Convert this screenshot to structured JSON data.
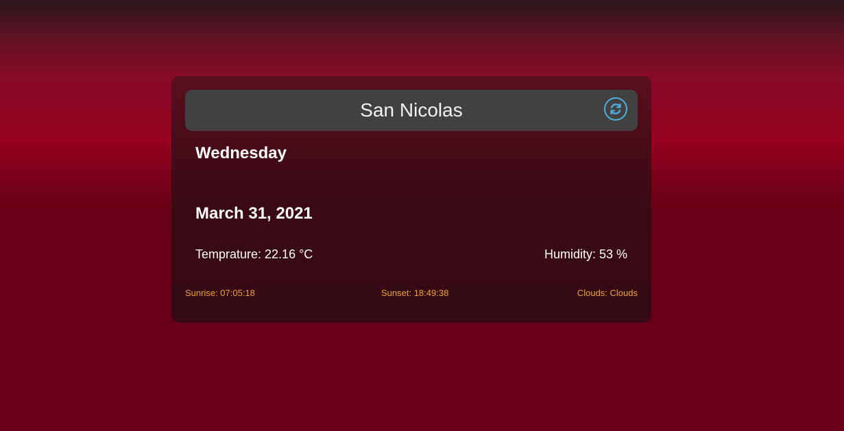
{
  "weather": {
    "city": "San Nicolas",
    "day": "Wednesday",
    "date": "March 31, 2021",
    "temperature": "Temprature: 22.16 °C",
    "humidity": "Humidity: 53 %",
    "sunrise": "Sunrise: 07:05:18",
    "sunset": "Sunset: 18:49:38",
    "clouds": "Clouds: Clouds"
  },
  "icons": {
    "refresh": "refresh-icon"
  },
  "colors": {
    "accent_icon": "#4fb0e0",
    "footer_text": "#e8a53a",
    "header_bg": "#414141"
  }
}
